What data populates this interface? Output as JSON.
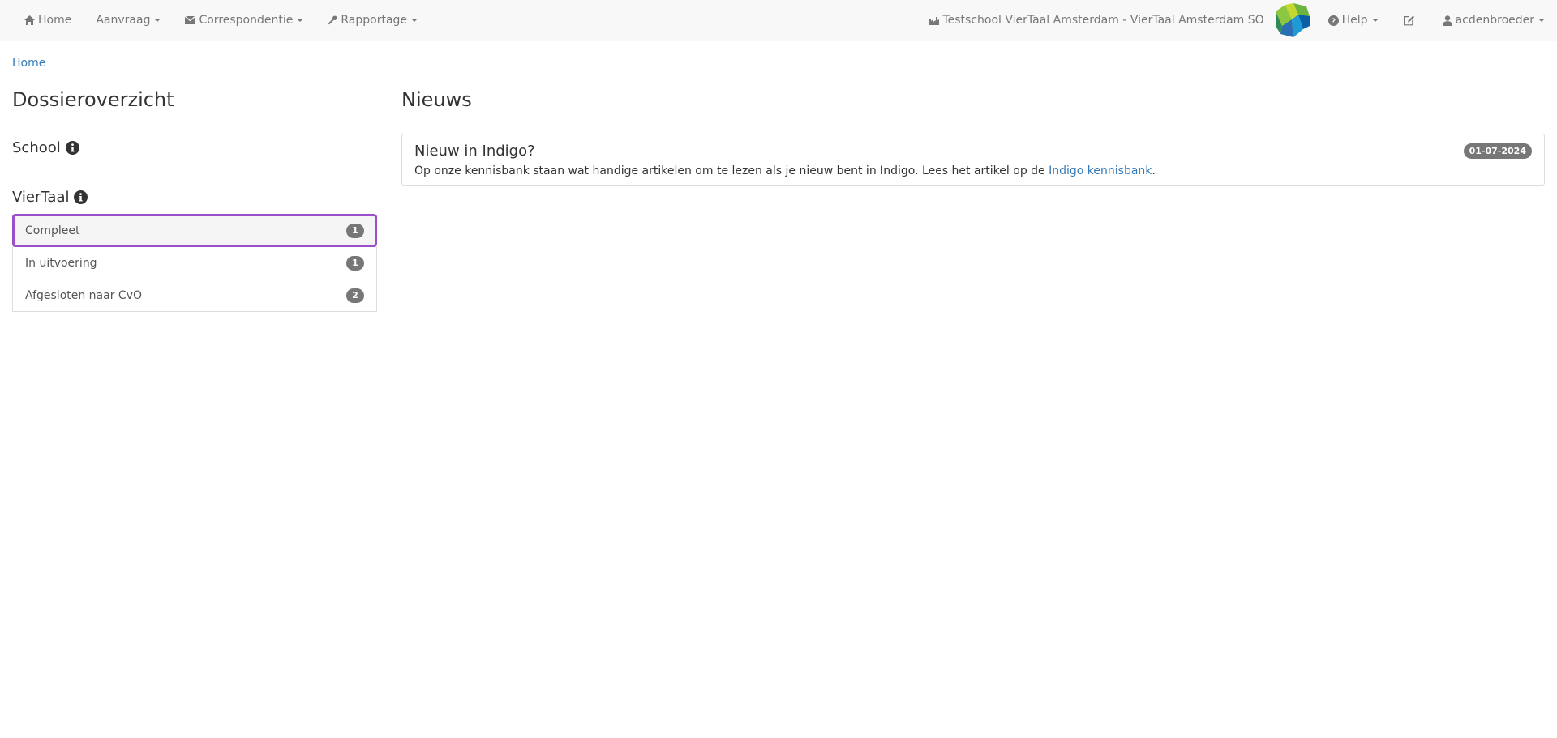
{
  "nav": {
    "home": "Home",
    "aanvraag": "Aanvraag",
    "correspondentie": "Correspondentie",
    "rapportage": "Rapportage",
    "school": "Testschool VierTaal Amsterdam - VierTaal Amsterdam SO",
    "help": "Help",
    "user": "acdenbroeder"
  },
  "breadcrumb": "Home",
  "left": {
    "title": "Dossieroverzicht",
    "school_heading": "School",
    "viertaal_heading": "VierTaal",
    "items": [
      {
        "label": "Compleet",
        "count": "1"
      },
      {
        "label": "In uitvoering",
        "count": "1"
      },
      {
        "label": "Afgesloten naar CvO",
        "count": "2"
      }
    ]
  },
  "news": {
    "title": "Nieuws",
    "items": [
      {
        "title": "Nieuw in Indigo?",
        "date": "01-07-2024",
        "text_before": "Op onze kennisbank staan wat handige artikelen om te lezen als je nieuw bent in Indigo. Lees het artikel op de ",
        "link": "Indigo kennisbank",
        "text_after": "."
      }
    ]
  },
  "colors": {
    "link": "#337ab7",
    "badge": "#777777",
    "highlight": "#9b4fc8",
    "heading_rule": "#1a4f7a"
  },
  "icons": [
    "home-icon",
    "envelope-icon",
    "wrench-icon",
    "building-icon",
    "logo-icon",
    "question-circle-icon",
    "edit-icon",
    "user-icon",
    "info-circle-icon"
  ]
}
